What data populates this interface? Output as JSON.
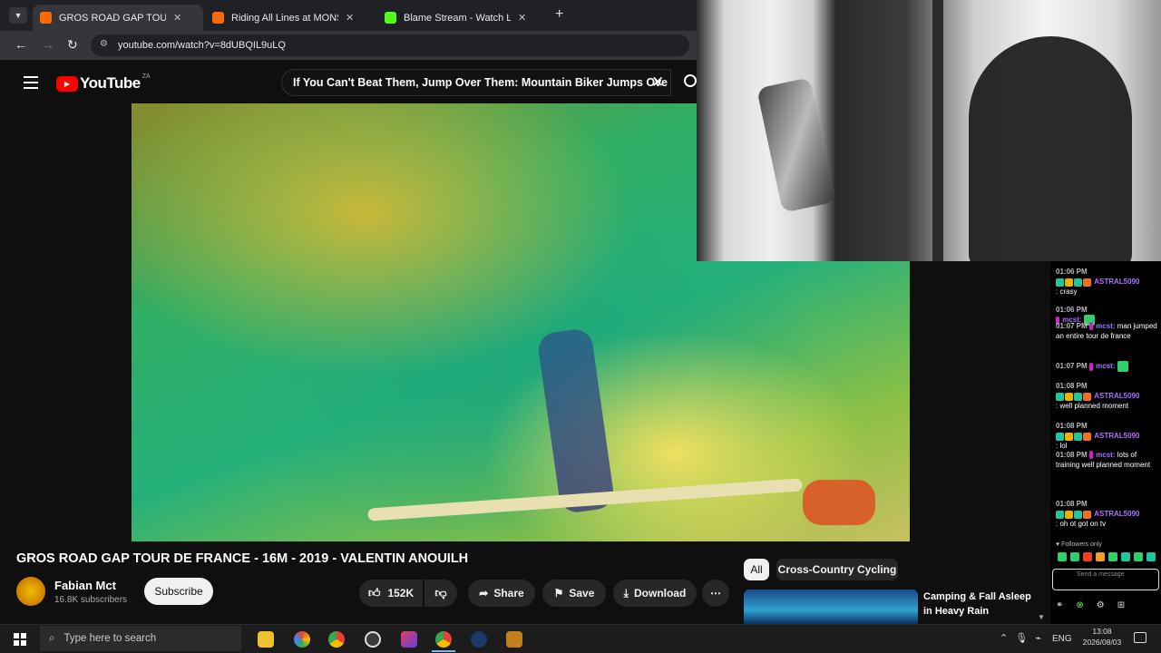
{
  "browser": {
    "tabs": [
      {
        "title": "GROS ROAD GAP TOUR DE",
        "color": "#ff0000",
        "active": true
      },
      {
        "title": "Riding All Lines at MONST",
        "color": "#ff0000",
        "active": false
      },
      {
        "title": "Blame Stream - Watch Live on",
        "color": "#53fc18",
        "active": false
      }
    ],
    "url": "youtube.com/watch?v=8dUBQIL9uLQ"
  },
  "youtube": {
    "logo_text": "YouTube",
    "logo_region": "ZA",
    "search_value": "If You Can't Beat Them, Jump Over Them: Mountain Biker Jumps Ove",
    "video_title": "GROS ROAD GAP TOUR DE FRANCE - 16M - 2019 - VALENTIN ANOUILH",
    "channel_name": "Fabian Mct",
    "subscribers": "16.8K subscribers",
    "subscribe_label": "Subscribe",
    "likes": "152K",
    "share_label": "Share",
    "save_label": "Save",
    "download_label": "Download",
    "chips": [
      "All",
      "Cross-Country Cycling"
    ],
    "rec_title": "Camping & Fall Asleep in Heavy Rain"
  },
  "chat": {
    "messages": [
      {
        "time": "01:06 PM",
        "user": "ASTRAL5090",
        "text": ": crasy",
        "color": "#a970ff"
      },
      {
        "time": "01:06 PM",
        "user": "mcst:",
        "text": "",
        "color": "#a970ff"
      },
      {
        "time": "01:07 PM",
        "user": "mcst:",
        "text": "man jumped an entire tour de france",
        "color": "#a970ff"
      },
      {
        "time": "01:07 PM",
        "user": "mcst:",
        "text": "",
        "color": "#a970ff"
      },
      {
        "time": "01:08 PM",
        "user": "ASTRAL5090",
        "text": ": well planned moment",
        "color": "#a970ff"
      },
      {
        "time": "01:08 PM",
        "user": "ASTRAL5090",
        "text": ": lol",
        "color": "#a970ff"
      },
      {
        "time": "01:08 PM",
        "user": "mcst:",
        "text": "lots of training well planned moment",
        "color": "#a970ff"
      },
      {
        "time": "01:08 PM",
        "user": "ASTRAL5090",
        "text": ": oh ot got on tv",
        "color": "#a970ff"
      }
    ],
    "followers_only": "Followers only",
    "send_placeholder": "Send a message"
  },
  "taskbar": {
    "search_placeholder": "Type here to search",
    "lang": "ENG",
    "time": "13:08",
    "date": "2026/08/03"
  }
}
